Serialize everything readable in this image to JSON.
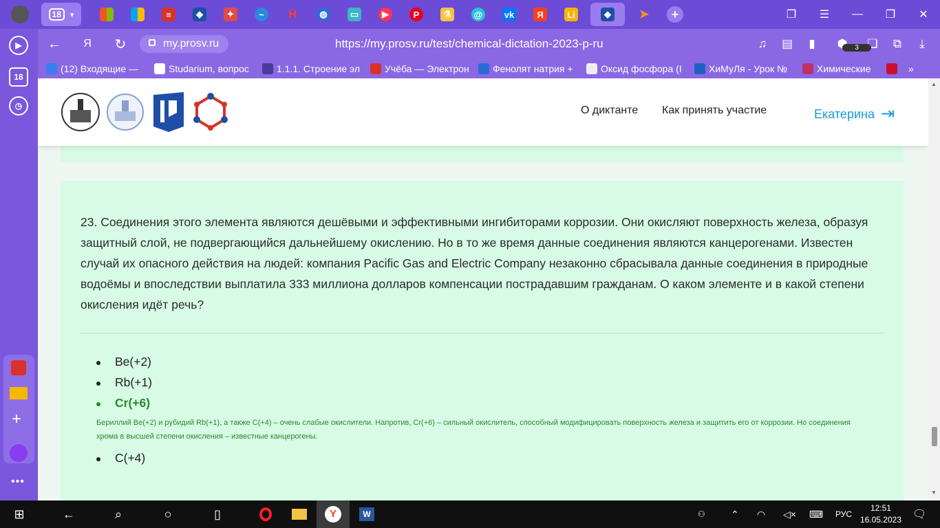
{
  "browser": {
    "tab_counter": "18",
    "domain": "my.prosv.ru",
    "url": "https://my.prosv.ru/test/chemical-dictation-2023-p-ru",
    "downloads_badge": "3",
    "sidebar_counter": "18",
    "bookmarks": [
      "(12) Входящие — ",
      "Studarium, вопрос",
      "1.1.1. Строение эл",
      "Учёба — Электрон",
      "Фенолят натрия +",
      "Оксид фосфора (I",
      "ХиМуЛя - Урок №",
      "Химические"
    ]
  },
  "site": {
    "nav": {
      "about": "О диктанте",
      "how": "Как принять участие",
      "user": "Екатерина"
    }
  },
  "question": {
    "text": "23. Соединения этого элемента являются дешёвыми и эффективными ингибиторами коррозии. Они окисляют поверхность железа, образуя защитный слой, не подвергающийся дальнейшему окислению. Но в то же время данные соединения являются канцерогенами. Известен случай их опасного действия на людей: компания Pacific Gas and Electric Company незаконно сбрасывала данные соединения в природные водоёмы и впоследствии выплатила 333 миллиона долларов компенсации пострадавшим гражданам. О каком элементе и в какой степени окисления идёт речь?",
    "options": [
      "Be(+2)",
      "Rb(+1)",
      "Cr(+6)",
      "C(+4)"
    ],
    "correct_index": 2,
    "explanation": "Бериллий Be(+2) и рубидий Rb(+1), а также C(+4) – очень слабые окислители. Напротив, Cr(+6) – сильный окислитель, способный модифицировать поверхность железа и защитить его от коррозии. Но соединения хрома в высшей степени окисления – известные канцерогены."
  },
  "taskbar": {
    "lang": "РУС",
    "time": "12:51",
    "date": "16.05.2023"
  },
  "colors": {
    "browser_accent": "#6c4bd6",
    "card_bg": "#d7fbe5",
    "correct": "#2a8a2a",
    "user_link": "#1a9ad6"
  }
}
